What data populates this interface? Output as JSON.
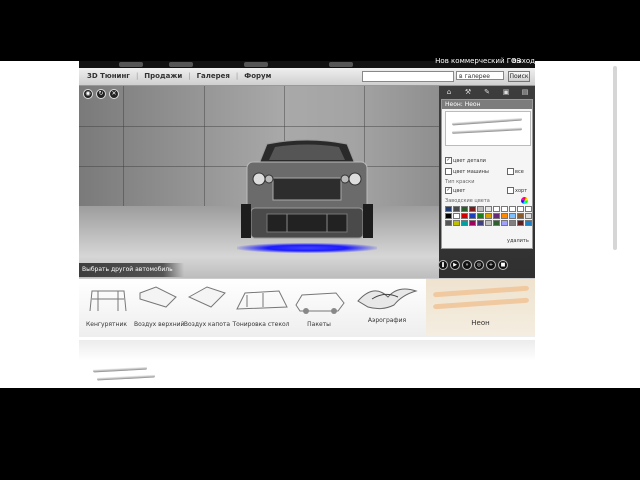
{
  "top_strip": {
    "link": "Нов коммерческий ГОЗ",
    "exit": "выход"
  },
  "nav": {
    "items": [
      "3D Тюнинг",
      "Продажи",
      "Галерея",
      "Форум"
    ]
  },
  "search": {
    "placeholder": "",
    "scope_value": "в галерее",
    "button": "Поиск"
  },
  "stage": {
    "choose_car": "Выбрать другой автомобиль"
  },
  "stage_icons": [
    "camera-icon",
    "rotate-icon",
    "wrench-icon"
  ],
  "right_panel": {
    "tabs": [
      "home-icon",
      "tools-icon",
      "paint-icon",
      "image-icon",
      "save-icon"
    ],
    "title": "Неон: Неон",
    "chk_parts": "цвет детали",
    "chk_car": "цвет машины",
    "chk_all": "все",
    "type_label": "Тип краски",
    "type_opt1": "цвет",
    "type_opt2": "хорт",
    "palette_label": "Заводские цвета",
    "delete": "удалить",
    "swatches": [
      "#1f3b73",
      "#4b4b4b",
      "#2b5c2b",
      "#7a1a1a",
      "#bcbcbc",
      "#e6e6e6",
      "#ffffff",
      "#ffffff",
      "#ffffff",
      "#ffffff",
      "#ffffff",
      "#000000",
      "#ffffff",
      "#d40000",
      "#1c3fbf",
      "#1a7f1a",
      "#d8a000",
      "#6a2a7a",
      "#ff8800",
      "#7fbfff",
      "#8a5a2a",
      "#dddddd",
      "#555555",
      "#bfbf00",
      "#00a0a0",
      "#a00060",
      "#404080",
      "#c0c0c0",
      "#306030",
      "#a0a0ff",
      "#808080",
      "#602020",
      "#2080c0"
    ]
  },
  "player_icons": [
    "pause-icon",
    "play-icon",
    "next-icon",
    "target-icon",
    "zoom-icon",
    "stop-icon"
  ],
  "categories": [
    {
      "label": "Кенгурятник"
    },
    {
      "label": "Воздух верхний"
    },
    {
      "label": "Воздух капота"
    },
    {
      "label": "Тонировка стекол"
    },
    {
      "label": "Пакеты"
    },
    {
      "label": "Аэрография"
    },
    {
      "label": "Неон"
    }
  ],
  "colors": {
    "neon": "#2020ff",
    "active_category": "#efe3cf",
    "panel_dark": "#3a3a3a"
  }
}
